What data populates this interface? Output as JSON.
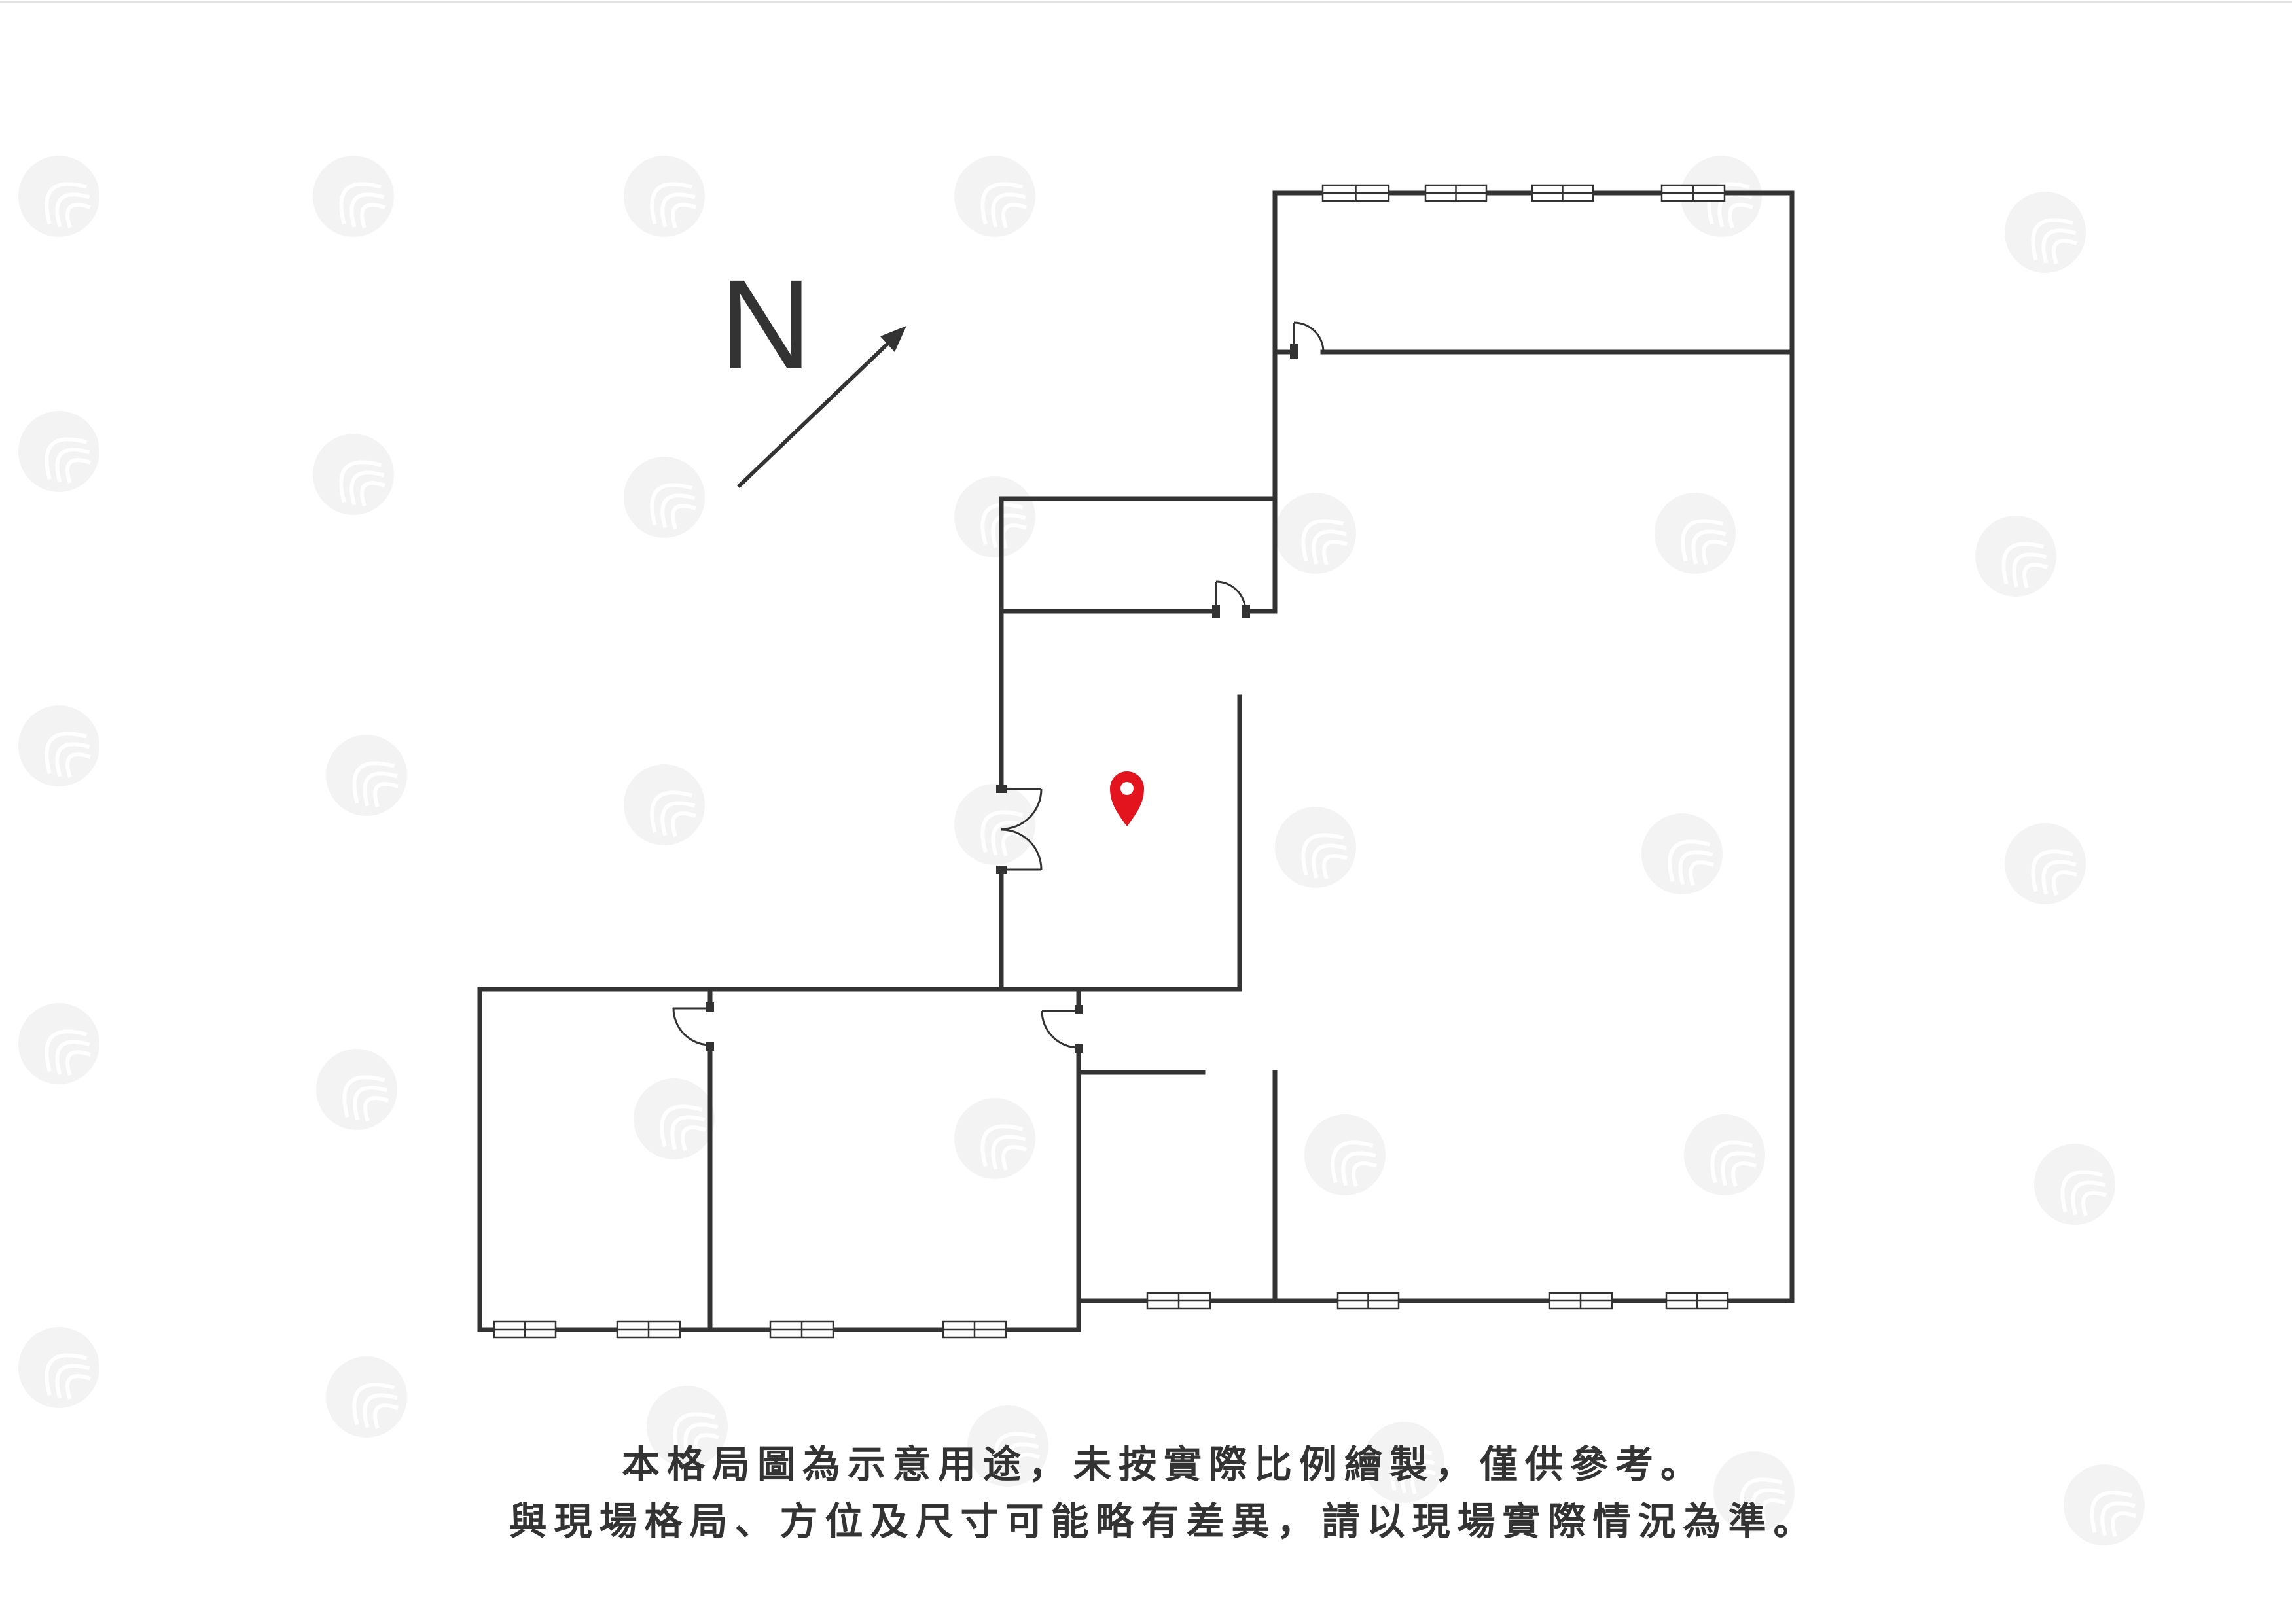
{
  "compass": {
    "label": "N"
  },
  "disclaimer": {
    "line1": "本格局圖為示意用途，未按實際比例繪製，僅供參考。",
    "line2": "與現場格局、方位及尺寸可能略有差異，請以現場實際情況為準。"
  },
  "colors": {
    "background": "#ffffff",
    "wall": "#333333",
    "pin": "#e3141d",
    "text": "#333333",
    "watermark": "#f3f3f3"
  },
  "icons": {
    "north_arrow": "arrow-northeast-icon",
    "location": "map-pin-icon",
    "watermark": "watermark-logo-icon"
  }
}
